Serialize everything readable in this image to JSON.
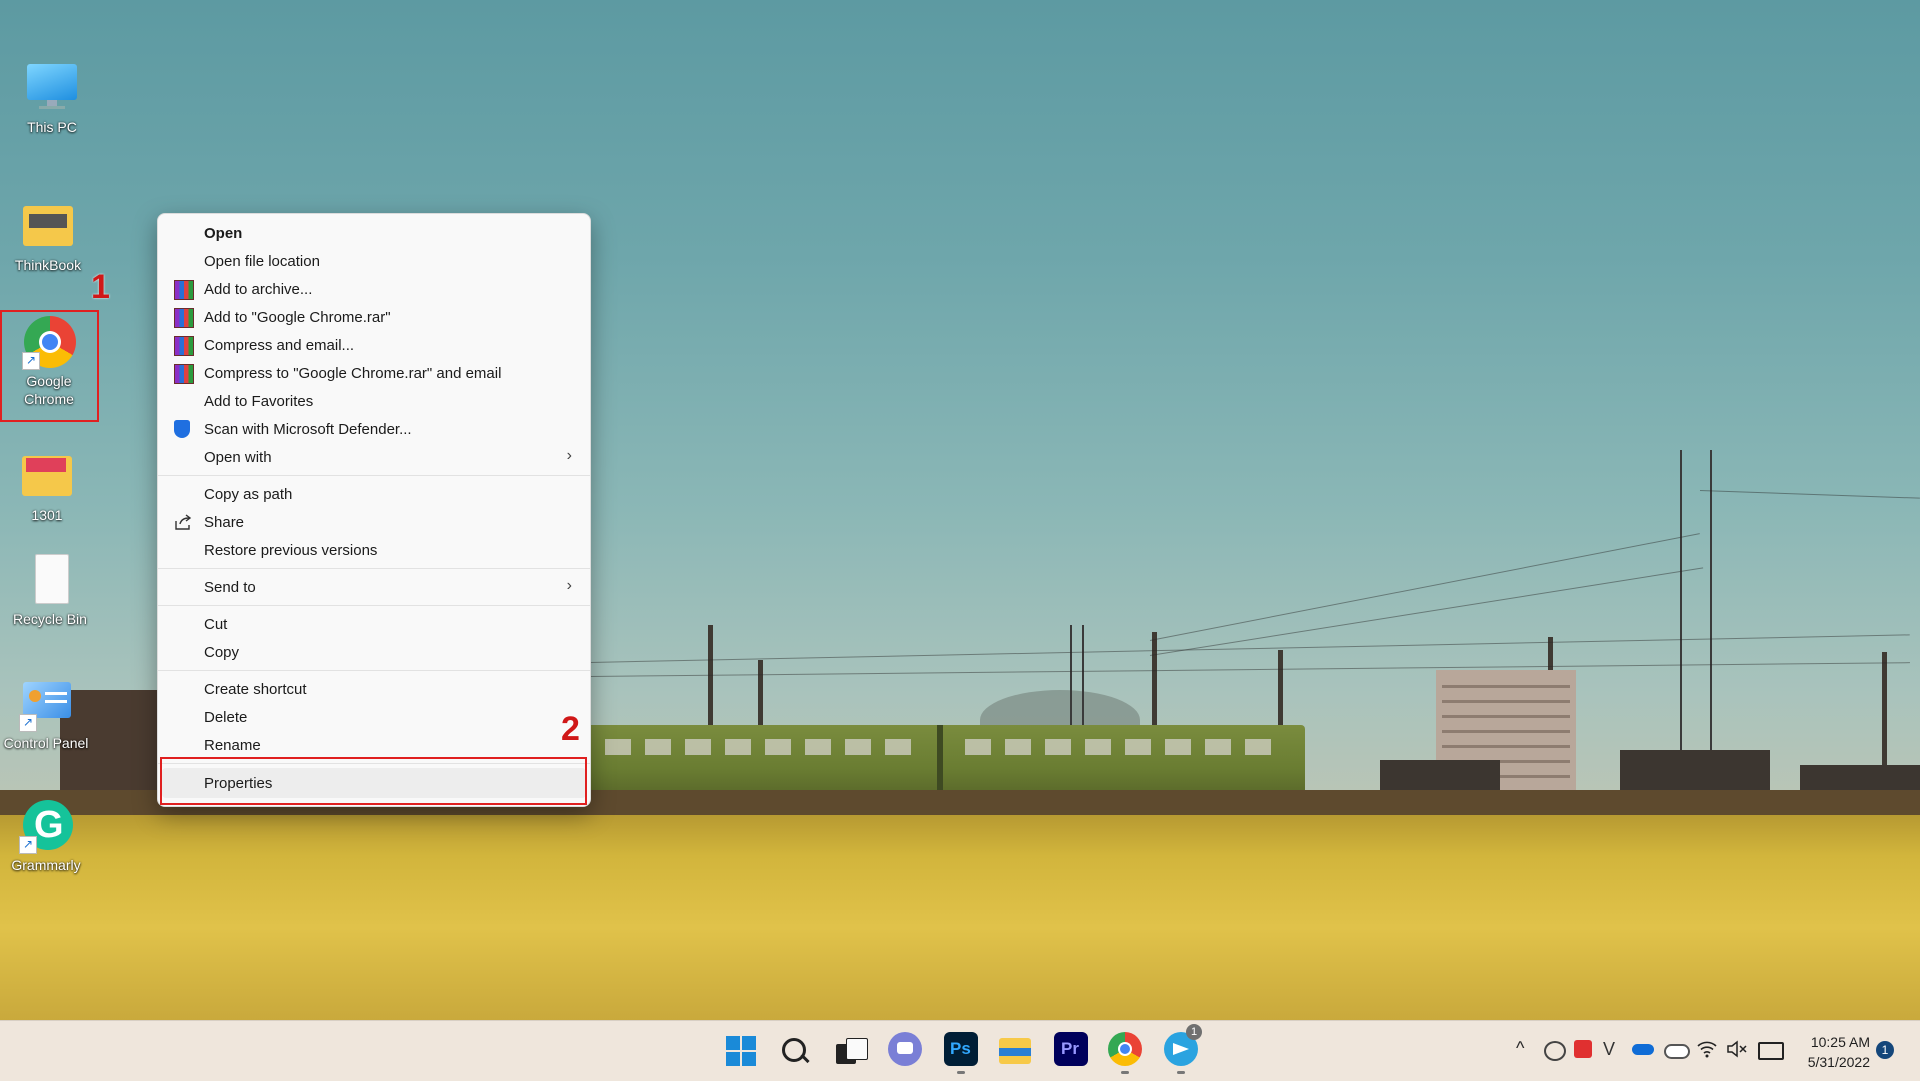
{
  "desktop": {
    "icons": [
      {
        "label": "This PC"
      },
      {
        "label": "ThinkBook"
      },
      {
        "label": "Google Chrome"
      },
      {
        "label": "1301"
      },
      {
        "label": "Recycle Bin"
      },
      {
        "label": "Control Panel"
      },
      {
        "label": "Grammarly"
      }
    ],
    "annotations": {
      "step1": "1",
      "step2": "2"
    },
    "highlight_color": "#e02020"
  },
  "context_menu": {
    "items": [
      {
        "label": "Open",
        "icon": "none"
      },
      {
        "label": "Open file location",
        "icon": "none"
      },
      {
        "label": "Add to archive...",
        "icon": "winrar-icon"
      },
      {
        "label": "Add to \"Google Chrome.rar\"",
        "icon": "winrar-icon"
      },
      {
        "label": "Compress and email...",
        "icon": "winrar-icon"
      },
      {
        "label": "Compress to \"Google Chrome.rar\" and email",
        "icon": "winrar-icon"
      },
      {
        "label": "Add to Favorites",
        "icon": "none"
      },
      {
        "label": "Scan with Microsoft Defender...",
        "icon": "defender-shield-icon"
      },
      {
        "label": "Open with",
        "icon": "none",
        "submenu": true
      },
      {
        "label": "Copy as path",
        "icon": "none"
      },
      {
        "label": "Share",
        "icon": "share-icon"
      },
      {
        "label": "Restore previous versions",
        "icon": "none"
      },
      {
        "label": "Send to",
        "icon": "none",
        "submenu": true
      },
      {
        "label": "Cut",
        "icon": "none"
      },
      {
        "label": "Copy",
        "icon": "none"
      },
      {
        "label": "Create shortcut",
        "icon": "none"
      },
      {
        "label": "Delete",
        "icon": "none"
      },
      {
        "label": "Rename",
        "icon": "none"
      },
      {
        "label": "Properties",
        "icon": "none"
      }
    ],
    "submenu_arrow": "›"
  },
  "taskbar": {
    "pinned": [
      "windows-start-icon",
      "search-icon",
      "task-view-icon",
      "teams-chat-icon",
      "photoshop-icon",
      "file-explorer-icon",
      "premiere-icon",
      "chrome-icon",
      "telegram-icon"
    ],
    "photoshop_text": "Ps",
    "premiere_text": "Pr",
    "telegram_badge": "1",
    "tray_chevron": "^",
    "clock_time": "10:25 AM",
    "clock_date": "5/31/2022",
    "notification_count": "1"
  }
}
